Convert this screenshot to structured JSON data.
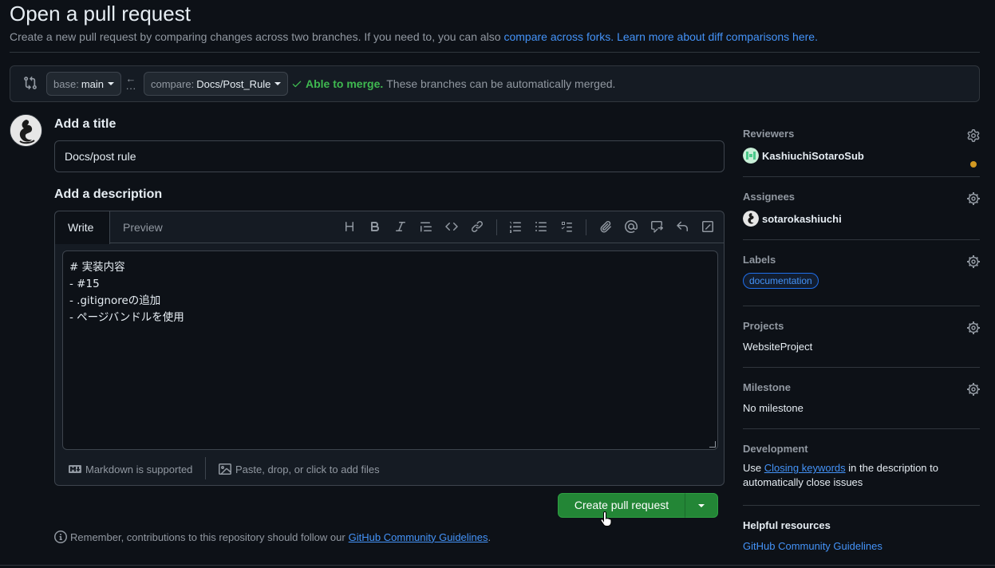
{
  "header": {
    "title": "Open a pull request",
    "subtitle_prefix": "Create a new pull request by comparing changes across two branches. If you need to, you can also",
    "link_forks": "compare across forks.",
    "link_learn": "Learn more about diff comparisons here."
  },
  "compare": {
    "base_prefix": "base:",
    "base_branch": "main",
    "compare_prefix": "compare:",
    "compare_branch": "Docs/Post_Rule",
    "merge_ok": "Able to merge.",
    "merge_msg": "These branches can be automatically merged."
  },
  "form": {
    "title_label": "Add a title",
    "title_value": "Docs/post rule",
    "description_label": "Add a description",
    "tab_write": "Write",
    "tab_preview": "Preview",
    "body_lines": [
      "# 実装内容",
      "- #15",
      "- .gitignoreの追加",
      "- ページバンドルを使用"
    ],
    "markdown_note": "Markdown is supported",
    "attach_note": "Paste, drop, or click to add files",
    "create_button": "Create pull request",
    "remember_text": "Remember, contributions to this repository should follow our",
    "remember_link": "GitHub Community Guidelines",
    "remember_end": "."
  },
  "toolbar": {
    "icons": [
      "heading-icon",
      "bold-icon",
      "italic-icon",
      "quote-icon",
      "code-icon",
      "link-icon",
      "ordered-list-icon",
      "unordered-list-icon",
      "task-list-icon",
      "attach-icon",
      "mention-icon",
      "reference-icon",
      "reply-icon",
      "slash-command-icon"
    ]
  },
  "sidebar": {
    "reviewers": {
      "title": "Reviewers",
      "user": "KashiuchiSotaroSub"
    },
    "assignees": {
      "title": "Assignees",
      "user": "sotarokashiuchi"
    },
    "labels": {
      "title": "Labels",
      "label": "documentation"
    },
    "projects": {
      "title": "Projects",
      "value": "WebsiteProject"
    },
    "milestone": {
      "title": "Milestone",
      "value": "No milestone"
    },
    "development": {
      "title": "Development",
      "text_prefix": "Use",
      "link": "Closing keywords",
      "text_suffix": "in the description to automatically close issues"
    },
    "resources": {
      "title": "Helpful resources",
      "link": "GitHub Community Guidelines"
    }
  },
  "colors": {
    "background": "#0d1117",
    "accent_link": "#4493f8",
    "success": "#3fb950",
    "button_green": "#238636",
    "pending": "#d29922"
  }
}
